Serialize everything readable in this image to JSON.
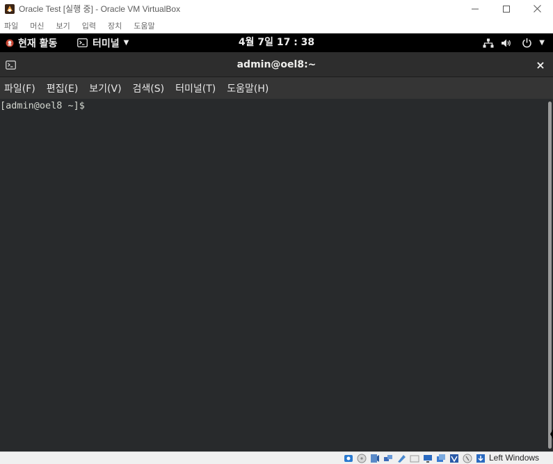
{
  "host_window": {
    "title": "Oracle Test [실행 중] - Oracle VM VirtualBox",
    "icon": "virtualbox-icon",
    "controls": [
      "minimize-icon",
      "maximize-icon",
      "close-icon"
    ]
  },
  "host_menu": {
    "items": [
      "파일",
      "머신",
      "보기",
      "입력",
      "장치",
      "도움말"
    ]
  },
  "gnome_topbar": {
    "activities": "현재 활동",
    "app_menu": "터미널",
    "clock": "4월 7일  17 : 38",
    "status_icons": [
      "network-wired-icon",
      "volume-icon",
      "power-icon",
      "chevron-down-icon"
    ]
  },
  "terminal": {
    "title": "admin@oel8:~",
    "close_glyph": "×",
    "menu": [
      "파일(F)",
      "편집(E)",
      "보기(V)",
      "검색(S)",
      "터미널(T)",
      "도움말(H)"
    ],
    "prompt": "[admin@oel8 ~]$ "
  },
  "status_bar": {
    "host_key": "Left Windows",
    "icons": [
      "hard-disk-icon",
      "optical-drive-icon",
      "audio-icon",
      "network-icon",
      "usb-icon",
      "shared-folders-icon",
      "display-icon",
      "video-capture-icon",
      "virtualization-icon",
      "mouse-integration-icon",
      "keyboard-capture-icon"
    ]
  },
  "colors": {
    "topbar": "#000000",
    "terminal_header": "#2d2d2d",
    "terminal_menubar": "#353535",
    "terminal_background": "#282a2c",
    "terminal_text": "#d3d7cf"
  }
}
